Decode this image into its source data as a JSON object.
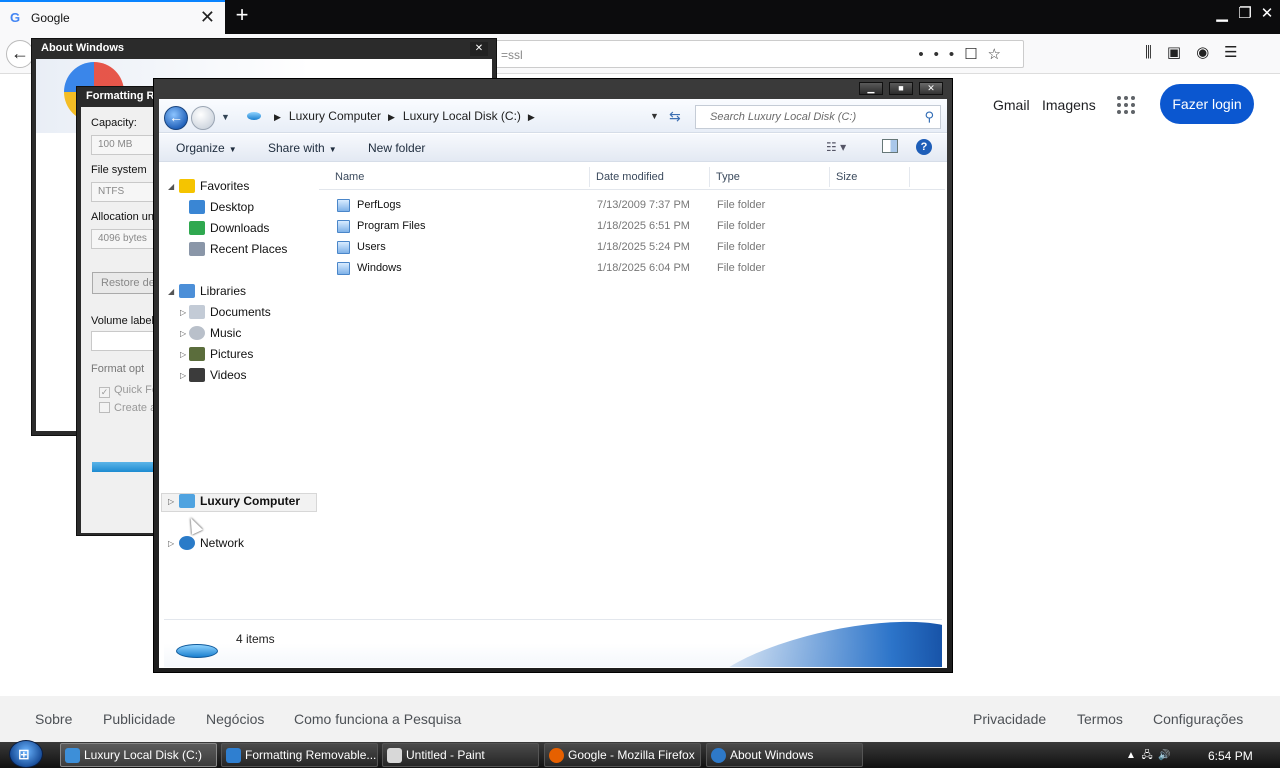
{
  "browser": {
    "tab_title": "Google",
    "tab_close": "✕",
    "new_tab": "+",
    "url_fragment": "=ssl",
    "window_controls": [
      "▁",
      "❐",
      "✕"
    ]
  },
  "google": {
    "gmail": "Gmail",
    "images": "Imagens",
    "login": "Fazer login",
    "footer_left": [
      "Sobre",
      "Publicidade",
      "Negócios",
      "Como funciona a Pesquisa"
    ],
    "footer_right": [
      "Privacidade",
      "Termos",
      "Configurações"
    ]
  },
  "about_window": {
    "title": "About Windows",
    "close": "✕"
  },
  "format_window": {
    "title": "Formatting R",
    "capacity_label": "Capacity:",
    "capacity_value": "100 MB",
    "filesystem_label": "File system",
    "filesystem_value": "NTFS",
    "allocation_label": "Allocation uni",
    "allocation_value": "4096 bytes",
    "restore_button": "Restore de",
    "volume_label": "Volume label",
    "format_options": "Format opt",
    "quick_format": "Quick Fo",
    "create": "Create a"
  },
  "explorer": {
    "breadcrumbs": [
      "Luxury Computer",
      "Luxury Local Disk (C:)"
    ],
    "search_placeholder": "Search Luxury Local Disk (C:)",
    "toolbar": {
      "organize": "Organize",
      "share_with": "Share with",
      "new_folder": "New folder"
    },
    "nav": {
      "favorites": "Favorites",
      "desktop": "Desktop",
      "downloads": "Downloads",
      "recent_places": "Recent Places",
      "libraries": "Libraries",
      "documents": "Documents",
      "music": "Music",
      "pictures": "Pictures",
      "videos": "Videos",
      "computer": "Luxury Computer",
      "network": "Network"
    },
    "columns": {
      "name": "Name",
      "date": "Date modified",
      "type": "Type",
      "size": "Size"
    },
    "rows": [
      {
        "name": "PerfLogs",
        "date": "7/13/2009 7:37 PM",
        "type": "File folder"
      },
      {
        "name": "Program Files",
        "date": "1/18/2025 6:51 PM",
        "type": "File folder"
      },
      {
        "name": "Users",
        "date": "1/18/2025 5:24 PM",
        "type": "File folder"
      },
      {
        "name": "Windows",
        "date": "1/18/2025 6:04 PM",
        "type": "File folder"
      }
    ],
    "item_count": "4 items"
  },
  "taskbar": {
    "buttons": [
      {
        "label": "Luxury Local Disk (C:)",
        "color": "#3d8fd8"
      },
      {
        "label": "Formatting Removable...",
        "color": "#2f7fd0"
      },
      {
        "label": "Untitled - Paint",
        "color": "#d8d8d8"
      },
      {
        "label": "Google - Mozilla Firefox",
        "color": "#e66000"
      },
      {
        "label": "About Windows",
        "color": "#2e79c8"
      }
    ],
    "clock": "6:54 PM"
  }
}
